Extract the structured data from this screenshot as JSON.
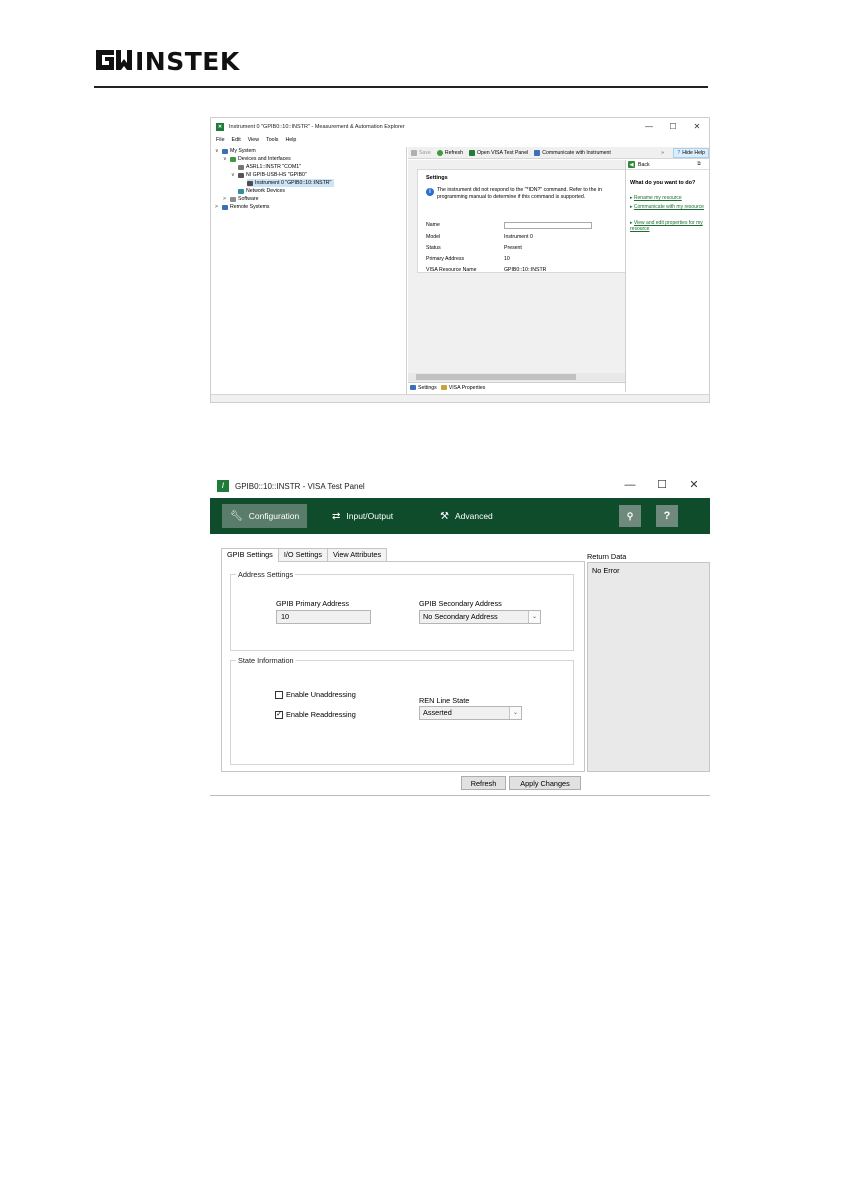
{
  "logo": {
    "brand": "GW INSTEK"
  },
  "max": {
    "title": "Instrument 0 \"GPIB0::10::INSTR\" - Measurement & Automation Explorer",
    "window_controls": {
      "minimize": "—",
      "maximize": "☐",
      "close": "✕"
    },
    "menu": [
      "File",
      "Edit",
      "View",
      "Tools",
      "Help"
    ],
    "tree": [
      {
        "label": "My System",
        "arrow": "∨"
      },
      {
        "label": "Devices and Interfaces",
        "arrow": "∨"
      },
      {
        "label": "ASRL1::INSTR \"COM1\"",
        "arrow": ""
      },
      {
        "label": "NI GPIB-USB-HS \"GPIB0\"",
        "arrow": "∨"
      },
      {
        "label": "Instrument 0 \"GPIB0::10::INSTR\"",
        "arrow": ""
      },
      {
        "label": "Network Devices",
        "arrow": ""
      },
      {
        "label": "Software",
        "arrow": ">"
      },
      {
        "label": "Remote Systems",
        "arrow": ">"
      }
    ],
    "toolbar": {
      "save": "Save",
      "refresh": "Refresh",
      "open_visa": "Open VISA Test Panel",
      "communicate": "Communicate with Instrument",
      "overflow": "»",
      "hide_help": "Hide Help"
    },
    "settings": {
      "title": "Settings",
      "info_line1": "The instrument did not respond to the \"*IDN?\" command. Refer to the in",
      "info_line2": "programming manual to determine if this command is supported.",
      "rows": [
        {
          "label": "Name",
          "value": ""
        },
        {
          "label": "Model",
          "value": "Instrument 0"
        },
        {
          "label": "Status",
          "value": "Present"
        },
        {
          "label": "Primary Address",
          "value": "10"
        },
        {
          "label": "VISA Resource Name",
          "value": "GPIB0::10::INSTR"
        }
      ]
    },
    "bottom_tabs": {
      "settings": "Settings",
      "visa_properties": "VISA Properties"
    },
    "help": {
      "back": "Back",
      "question": "What do you want to do?",
      "links": [
        "Rename my resource",
        "Communicate with my resource",
        "View and edit properties for my resource"
      ]
    }
  },
  "visa": {
    "title": "GPIB0::10::INSTR - VISA Test Panel",
    "window_controls": {
      "minimize": "—",
      "maximize": "☐",
      "close": "✕"
    },
    "nav": {
      "configuration": "Configuration",
      "input_output": "Input/Output",
      "advanced": "Advanced",
      "help": "?"
    },
    "tabs": [
      "GPIB Settings",
      "I/O Settings",
      "View Attributes"
    ],
    "address_settings": {
      "label": "Address Settings",
      "primary_label": "GPIB Primary Address",
      "primary_value": "10",
      "secondary_label": "GPIB Secondary Address",
      "secondary_value": "No Secondary Address"
    },
    "state_information": {
      "label": "State Information",
      "enable_unaddressing": {
        "label": "Enable Unaddressing",
        "checked": false
      },
      "enable_readdressing": {
        "label": "Enable Readdressing",
        "checked": true
      },
      "ren_label": "REN Line State",
      "ren_value": "Asserted"
    },
    "return_data": {
      "label": "Return Data",
      "value": "No Error"
    },
    "buttons": {
      "refresh": "Refresh",
      "apply": "Apply Changes"
    },
    "colors": {
      "navbar": "#0e4c2c",
      "active_tab": "#5a7c6a"
    }
  }
}
